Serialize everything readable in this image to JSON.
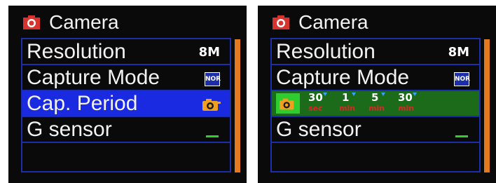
{
  "left_panel": {
    "header": {
      "title": "Camera"
    },
    "menu": [
      {
        "label": "Resolution",
        "value": "8M"
      },
      {
        "label": "Capture Mode",
        "value": "NOR"
      },
      {
        "label": "Cap. Period",
        "value": "capture-period-icon"
      },
      {
        "label": "G sensor",
        "value": "_"
      }
    ],
    "selected_row": "Cap. Period"
  },
  "right_panel": {
    "header": {
      "title": "Camera"
    },
    "menu": [
      {
        "label": "Resolution",
        "value": "8M"
      },
      {
        "label": "Capture Mode",
        "value": "NOR"
      },
      {
        "label": "G sensor",
        "value": "_"
      }
    ],
    "period_options": [
      {
        "num": "30",
        "unit": "sec"
      },
      {
        "num": "1",
        "unit": "min"
      },
      {
        "num": "5",
        "unit": "min"
      },
      {
        "num": "30",
        "unit": "min"
      }
    ]
  },
  "colors": {
    "menu_bg": "#0a0a0a",
    "border_blue": "#1c2fa8",
    "selected_blue": "#1a2ae0",
    "option_green": "#1b6b1b",
    "scroll_orange": "#e37a1f",
    "unit_red": "#e32222",
    "indicator_green": "#33cc33"
  }
}
